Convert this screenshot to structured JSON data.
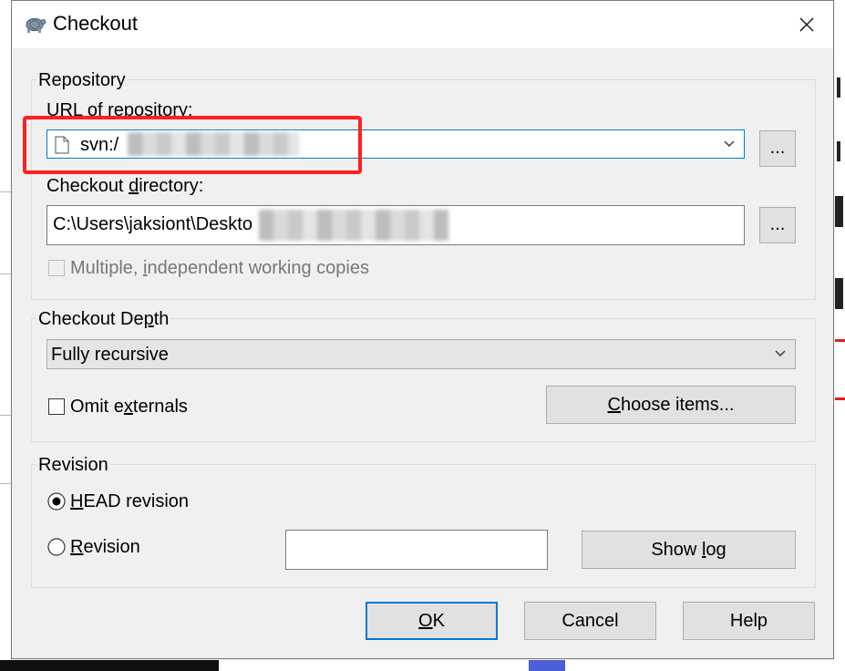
{
  "window": {
    "title": "Checkout",
    "close_glyph": "✕"
  },
  "repository": {
    "group_label": "Repository",
    "url_label": "URL of repository:",
    "url_value": "svn:/",
    "url_browse": "...",
    "dir_label": "Checkout directory:",
    "dir_value": "C:\\Users\\jaksiont\\Deskto",
    "dir_browse": "...",
    "multiple_copies_label": "Multiple, independent working copies",
    "multiple_copies_checked": false
  },
  "depth": {
    "group_label": "Checkout Depth",
    "selected": "Fully recursive",
    "omit_externals_label": "Omit externals",
    "omit_externals_checked": false,
    "choose_items": "Choose items..."
  },
  "revision": {
    "group_label": "Revision",
    "head_label": "HEAD revision",
    "head_selected": true,
    "revision_label": "Revision",
    "revision_selected": false,
    "revision_value": "",
    "show_log": "Show log"
  },
  "buttons": {
    "ok": "OK",
    "cancel": "Cancel",
    "help": "Help"
  },
  "icons": {
    "app": "tortoise-svn-icon",
    "close": "close-icon",
    "file": "document-icon",
    "dropdown": "chevron-down-icon"
  },
  "colors": {
    "focus": "#0078d7",
    "highlight": "#ff2020"
  }
}
